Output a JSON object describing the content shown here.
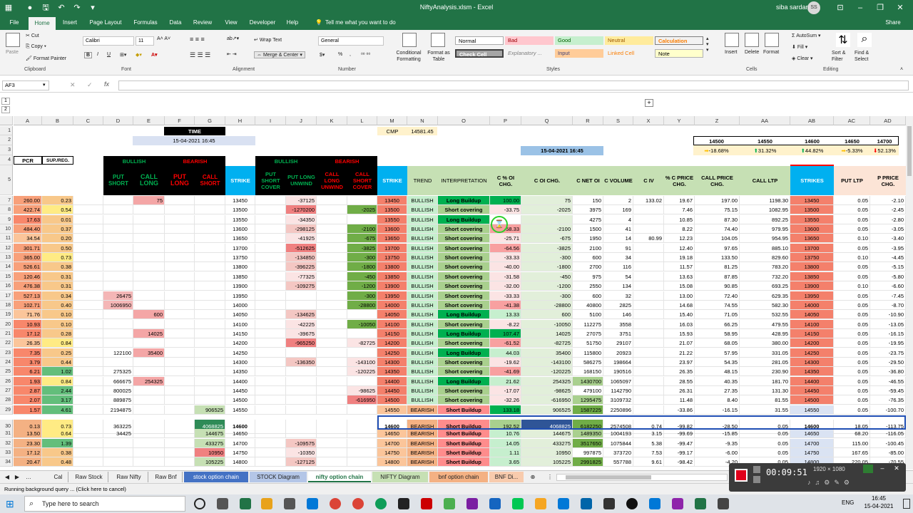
{
  "window": {
    "title": "NiftyAnalysis.xlsm - Excel",
    "user": "siba sardar",
    "avatar": "SS"
  },
  "menu": [
    "File",
    "Home",
    "Insert",
    "Page Layout",
    "Formulas",
    "Data",
    "Review",
    "Developer",
    "Help",
    "Tell me what you want to do",
    "Share"
  ],
  "ribbon": {
    "clipboard": {
      "paste": "Paste",
      "cut": "Cut",
      "copy": "Copy",
      "painter": "Format Painter",
      "label": "Clipboard"
    },
    "font": {
      "name": "Calibri",
      "size": "11",
      "label": "Font",
      "bold": "B",
      "italic": "I",
      "underline": "U"
    },
    "alignment": {
      "wrap": "Wrap Text",
      "merge": "Merge & Center",
      "label": "Alignment"
    },
    "number": {
      "format": "General",
      "label": "Number",
      "pct": "%"
    },
    "styles": {
      "cond": "Conditional Formatting",
      "table": "Format as Table",
      "normal": "Normal",
      "bad": "Bad",
      "good": "Good",
      "neutral": "Neutral",
      "calculation": "Calculation",
      "check": "Check Cell",
      "explanatory": "Explanatory ...",
      "input": "Input",
      "linked": "Linked Cell",
      "note": "Note",
      "label": "Styles"
    },
    "cells": {
      "insert": "Insert",
      "delete": "Delete",
      "format": "Format",
      "label": "Cells"
    },
    "editing": {
      "autosum": "AutoSum",
      "fill": "Fill",
      "clear": "Clear",
      "sort": "Sort & Filter",
      "find": "Find & Select",
      "label": "Editing"
    }
  },
  "formula": {
    "namebox": "AF3",
    "fx": "fx"
  },
  "columns": [
    "A",
    "B",
    "C",
    "D",
    "E",
    "F",
    "G",
    "H",
    "I",
    "J",
    "K",
    "L",
    "M",
    "N",
    "O",
    "P",
    "Q",
    "R",
    "S",
    "T",
    "U",
    "V",
    "W",
    "X",
    "Y",
    "Z",
    "AA",
    "AB",
    "AC",
    "AD"
  ],
  "top": {
    "time_label": "TIME",
    "time": "15-04-2021 16:45",
    "cmp_label": "CMP",
    "cmp": "14581.45",
    "time2": "15-04-2021 16:45",
    "strikes": [
      "14500",
      "14550",
      "14600",
      "14650",
      "14700"
    ],
    "pcts": [
      "-18.68%",
      "31.32%",
      "44.82%",
      "-5.33%",
      "52.13%"
    ]
  },
  "headers": {
    "pcr": "PCR",
    "supreg": "SUP./REG.",
    "bullish": "BULLISH",
    "bearish": "BEARISH",
    "put_short": "PUT SHORT",
    "call_long": "CALL LONG",
    "put_long": "PUT LONG",
    "call_short": "CALL SHORT",
    "strike": "STRIKE",
    "put_short_cover": "PUT SHORT COVER",
    "put_long_unwind": "PUT LONG UNWIND",
    "call_long_unwind": "CALL LONG UNWIND",
    "call_short_cover": "CALL SHORT COVER",
    "trend": "TREND",
    "interp": "INTERPRETATION",
    "c_pct_oi": "C % OI CHG.",
    "c_oi_chg": "C OI CHG.",
    "c_net_oi": "C NET OI",
    "c_volume": "C VOLUME",
    "c_iv": "C IV",
    "pct_c_price": "% C PRICE CHG.",
    "call_price_chg": "CALL PRICE CHG.",
    "call_ltp": "CALL LTP",
    "strikes": "STRIKES",
    "put_ltp": "PUT LTP",
    "p_price": "P PRICE CHG."
  },
  "rows": [
    {
      "n": "7",
      "a": "260.00",
      "b": "0.23",
      "e": "75",
      "h": "13450",
      "j": "-37125",
      "m": "13450",
      "t": "BULLISH",
      "i": "Long Buildup",
      "p": "100.00",
      "q": "75",
      "r": "150",
      "s": "2",
      "u": "133.02",
      "v": "19.67",
      "w": "197.00",
      "x": "1198.30",
      "ab": "13450",
      "ac": "0.05",
      "ad": "-2.10"
    },
    {
      "n": "8",
      "a": "422.74",
      "b": "0.54",
      "h": "13500",
      "j": "-1270200",
      "l": "-2025",
      "m": "13500",
      "t": "BULLISH",
      "i": "Short covering",
      "p": "-33.75",
      "q": "-2025",
      "r": "3975",
      "s": "169",
      "v": "7.46",
      "w": "75.15",
      "x": "1082.95",
      "ab": "13500",
      "ac": "0.05",
      "ad": "-2.45"
    },
    {
      "n": "9",
      "a": "17.63",
      "b": "0.01",
      "h": "13550",
      "j": "-34350",
      "m": "13550",
      "t": "BULLISH",
      "i": "Long Buildup",
      "p": "",
      "q": "",
      "r": "4275",
      "s": "4",
      "v": "10.85",
      "w": "87.30",
      "x": "892.25",
      "ab": "13550",
      "ac": "0.05",
      "ad": "-2.80"
    },
    {
      "n": "10",
      "a": "484.40",
      "b": "0.37",
      "h": "13600",
      "j": "-298125",
      "l": "-2100",
      "m": "13600",
      "t": "BULLISH",
      "i": "Short covering",
      "p": "-58.33",
      "q": "-2100",
      "r": "1500",
      "s": "41",
      "v": "8.22",
      "w": "74.40",
      "x": "979.95",
      "ab": "13600",
      "ac": "0.05",
      "ad": "-3.05"
    },
    {
      "n": "11",
      "a": "34.54",
      "b": "0.20",
      "h": "13650",
      "j": "-41925",
      "l": "-675",
      "m": "13650",
      "t": "BULLISH",
      "i": "Short covering",
      "p": "-25.71",
      "q": "-675",
      "r": "1950",
      "s": "14",
      "u": "80.99",
      "v": "12.23",
      "w": "104.05",
      "x": "954.95",
      "ab": "13650",
      "ac": "0.10",
      "ad": "-3.40"
    },
    {
      "n": "12",
      "a": "301.71",
      "b": "0.50",
      "h": "13700",
      "j": "-512625",
      "l": "-3825",
      "m": "13700",
      "t": "BULLISH",
      "i": "Short covering",
      "p": "-64.56",
      "q": "-3825",
      "r": "2100",
      "s": "91",
      "v": "12.40",
      "w": "97.65",
      "x": "885.10",
      "ab": "13700",
      "ac": "0.05",
      "ad": "-3.95"
    },
    {
      "n": "13",
      "a": "365.00",
      "b": "0.73",
      "h": "13750",
      "j": "-134850",
      "l": "-300",
      "m": "13750",
      "t": "BULLISH",
      "i": "Short covering",
      "p": "-33.33",
      "q": "-300",
      "r": "600",
      "s": "34",
      "v": "19.18",
      "w": "133.50",
      "x": "829.60",
      "ab": "13750",
      "ac": "0.10",
      "ad": "-4.45"
    },
    {
      "n": "14",
      "a": "526.61",
      "b": "0.38",
      "h": "13800",
      "j": "-396225",
      "l": "-1800",
      "m": "13800",
      "t": "BULLISH",
      "i": "Short covering",
      "p": "-40.00",
      "q": "-1800",
      "r": "2700",
      "s": "116",
      "v": "11.57",
      "w": "81.25",
      "x": "783.20",
      "ab": "13800",
      "ac": "0.05",
      "ad": "-5.15"
    },
    {
      "n": "15",
      "a": "120.46",
      "b": "0.31",
      "h": "13850",
      "j": "-77325",
      "l": "-450",
      "m": "13850",
      "t": "BULLISH",
      "i": "Short covering",
      "p": "-31.58",
      "q": "-450",
      "r": "975",
      "s": "54",
      "v": "13.63",
      "w": "87.85",
      "x": "732.20",
      "ab": "13850",
      "ac": "0.05",
      "ad": "-5.80"
    },
    {
      "n": "16",
      "a": "476.38",
      "b": "0.31",
      "h": "13900",
      "j": "-109275",
      "l": "-1200",
      "m": "13900",
      "t": "BULLISH",
      "i": "Short covering",
      "p": "-32.00",
      "q": "-1200",
      "r": "2550",
      "s": "134",
      "v": "15.08",
      "w": "90.85",
      "x": "693.25",
      "ab": "13900",
      "ac": "0.10",
      "ad": "-6.60"
    },
    {
      "n": "17",
      "a": "527.13",
      "b": "0.34",
      "d": "26475",
      "h": "13950",
      "l": "-300",
      "m": "13950",
      "t": "BULLISH",
      "i": "Short covering",
      "p": "-33.33",
      "q": "-300",
      "r": "600",
      "s": "32",
      "v": "13.00",
      "w": "72.40",
      "x": "629.35",
      "ab": "13950",
      "ac": "0.05",
      "ad": "-7.45"
    },
    {
      "n": "18",
      "a": "102.71",
      "b": "0.40",
      "d": "1006950",
      "h": "14000",
      "l": "-28800",
      "m": "14000",
      "t": "BULLISH",
      "i": "Short covering",
      "p": "-41.38",
      "q": "-28800",
      "r": "40800",
      "s": "2825",
      "v": "14.68",
      "w": "74.55",
      "x": "582.30",
      "ab": "14000",
      "ac": "0.05",
      "ad": "-8.70"
    },
    {
      "n": "19",
      "a": "71.76",
      "b": "0.10",
      "e": "600",
      "h": "14050",
      "j": "-134625",
      "m": "14050",
      "t": "BULLISH",
      "i": "Long Buildup",
      "p": "13.33",
      "q": "600",
      "r": "5100",
      "s": "146",
      "v": "15.40",
      "w": "71.05",
      "x": "532.55",
      "ab": "14050",
      "ac": "0.05",
      "ad": "-10.90"
    },
    {
      "n": "20",
      "a": "10.93",
      "b": "0.10",
      "h": "14100",
      "j": "-42225",
      "l": "-10050",
      "m": "14100",
      "t": "BULLISH",
      "i": "Short covering",
      "p": "-8.22",
      "q": "-10050",
      "r": "112275",
      "s": "3558",
      "v": "16.03",
      "w": "66.25",
      "x": "479.55",
      "ab": "14100",
      "ac": "0.05",
      "ad": "-13.05"
    },
    {
      "n": "21",
      "a": "17.12",
      "b": "0.28",
      "e": "14025",
      "h": "14150",
      "j": "-39675",
      "m": "14150",
      "t": "BULLISH",
      "i": "Long Buildup",
      "p": "107.47",
      "q": "14025",
      "r": "27075",
      "s": "3751",
      "v": "15.93",
      "w": "58.95",
      "x": "428.95",
      "ab": "14150",
      "ac": "0.05",
      "ad": "-16.15"
    },
    {
      "n": "22",
      "a": "26.35",
      "b": "0.84",
      "h": "14200",
      "j": "-965250",
      "l": "-82725",
      "m": "14200",
      "t": "BULLISH",
      "i": "Short covering",
      "p": "-61.52",
      "q": "-82725",
      "r": "51750",
      "s": "29107",
      "v": "21.07",
      "w": "68.05",
      "x": "380.00",
      "ab": "14200",
      "ac": "0.05",
      "ad": "-19.95"
    },
    {
      "n": "23",
      "a": "7.35",
      "b": "0.25",
      "d": "122100",
      "e": "35400",
      "h": "14250",
      "m": "14250",
      "t": "BULLISH",
      "i": "Long Buildup",
      "p": "44.03",
      "q": "35400",
      "r": "115800",
      "s": "20923",
      "v": "21.22",
      "w": "57.95",
      "x": "331.05",
      "ab": "14250",
      "ac": "0.05",
      "ad": "-23.75"
    },
    {
      "n": "24",
      "a": "3.79",
      "b": "0.44",
      "h": "14300",
      "j": "-136350",
      "l": "-143100",
      "m": "14300",
      "t": "BULLISH",
      "i": "Short covering",
      "p": "-19.62",
      "q": "-143100",
      "r": "586275",
      "s": "198664",
      "v": "23.97",
      "w": "54.35",
      "x": "281.05",
      "ab": "14300",
      "ac": "0.05",
      "ad": "-29.50"
    },
    {
      "n": "25",
      "a": "6.21",
      "b": "1.02",
      "d": "275325",
      "h": "14350",
      "l": "-120225",
      "m": "14350",
      "t": "BULLISH",
      "i": "Short covering",
      "p": "-41.69",
      "q": "-120225",
      "r": "168150",
      "s": "190516",
      "v": "26.35",
      "w": "48.15",
      "x": "230.90",
      "ab": "14350",
      "ac": "0.05",
      "ad": "-36.80"
    },
    {
      "n": "26",
      "a": "1.93",
      "b": "0.84",
      "d": "666675",
      "e": "254325",
      "h": "14400",
      "m": "14400",
      "t": "BULLISH",
      "i": "Long Buildup",
      "p": "21.62",
      "q": "254325",
      "r": "1430700",
      "s": "1065097",
      "v": "28.55",
      "w": "40.35",
      "x": "181.70",
      "ab": "14400",
      "ac": "0.05",
      "ad": "-46.55"
    },
    {
      "n": "27",
      "a": "2.87",
      "b": "2.44",
      "d": "800025",
      "h": "14450",
      "l": "-98625",
      "m": "14450",
      "t": "BULLISH",
      "i": "Short covering",
      "p": "-17.07",
      "q": "-98625",
      "r": "479100",
      "s": "1142790",
      "v": "26.31",
      "w": "27.35",
      "x": "131.30",
      "ab": "14450",
      "ac": "0.05",
      "ad": "-59.45"
    },
    {
      "n": "28",
      "a": "2.07",
      "b": "3.17",
      "d": "889875",
      "h": "14500",
      "l": "-616950",
      "m": "14500",
      "t": "BULLISH",
      "i": "Short covering",
      "p": "-32.26",
      "q": "-616950",
      "r": "1295475",
      "s": "3109732",
      "v": "11.48",
      "w": "8.40",
      "x": "81.55",
      "ab": "14500",
      "ac": "0.05",
      "ad": "-76.35"
    },
    {
      "n": "29",
      "a": "1.57",
      "b": "4.61",
      "d": "2194875",
      "g": "906525",
      "h": "14550",
      "m": "14550",
      "t": "BEARISH",
      "i": "Short Buildup",
      "p": "133.18",
      "q": "906525",
      "r": "1587225",
      "s": "2250896",
      "v": "-33.86",
      "w": "-16.15",
      "x": "31.55",
      "ab": "14550",
      "ac": "0.05",
      "ad": "-100.70"
    },
    {
      "n": "30",
      "a": "0.13",
      "b": "0.73",
      "d": "363225",
      "g": "4068825",
      "h": "14600",
      "m": "14600",
      "t": "BEARISH",
      "i": "Short Buildup",
      "p": "192.52",
      "q": "4068825",
      "r": "6182250",
      "s": "2574508",
      "u": "0.74",
      "v": "-99.82",
      "w": "-28.50",
      "x": "0.05",
      "ab": "14600",
      "ac": "18.05",
      "ad": "-113.75"
    },
    {
      "n": "31",
      "a": "13.50",
      "b": "0.64",
      "d": "34425",
      "g": "144675",
      "h": "14650",
      "m": "14650",
      "t": "BEARISH",
      "i": "Short Buildup",
      "p": "10.76",
      "q": "144675",
      "r": "1489350",
      "s": "1004193",
      "u": "3.15",
      "v": "-99.69",
      "w": "-15.85",
      "x": "0.05",
      "ab": "14650",
      "ac": "68.20",
      "ad": "-116.05"
    },
    {
      "n": "32",
      "a": "23.30",
      "b": "1.39",
      "g": "433275",
      "h": "14700",
      "j": "-109575",
      "m": "14700",
      "t": "BEARISH",
      "i": "Short Buildup",
      "p": "14.05",
      "q": "433275",
      "r": "3517650",
      "s": "1075844",
      "u": "5.38",
      "v": "-99.47",
      "w": "-9.35",
      "x": "0.05",
      "ab": "14700",
      "ac": "115.00",
      "ad": "-100.45"
    },
    {
      "n": "33",
      "a": "17.12",
      "b": "0.38",
      "g": "10950",
      "h": "14750",
      "j": "-10350",
      "m": "14750",
      "t": "BEARISH",
      "i": "Short Buildup",
      "p": "1.11",
      "q": "10950",
      "r": "997875",
      "s": "373720",
      "u": "7.53",
      "v": "-99.17",
      "w": "-6.00",
      "x": "0.05",
      "ab": "14750",
      "ac": "167.65",
      "ad": "-85.00"
    },
    {
      "n": "34",
      "a": "20.47",
      "b": "0.48",
      "g": "105225",
      "h": "14800",
      "j": "-127125",
      "m": "14800",
      "t": "BEARISH",
      "i": "Short Buildup",
      "p": "3.65",
      "q": "105225",
      "r": "2991825",
      "s": "557788",
      "u": "9.61",
      "v": "-98.42",
      "w": "-4.20",
      "x": "0.05",
      "ab": "14800",
      "ac": "220.05",
      "ad": "-70.55"
    }
  ],
  "sheets": [
    "Cal",
    "Raw Stock",
    "Raw Nifty",
    "Raw Bnf",
    "stock option chain",
    "STOCK Diagram",
    "nifty option chain",
    "NIFTY Diagram",
    "bnf option chain",
    "BNF Di..."
  ],
  "status": "Running background query ... (Click here to cancel)",
  "recorder": {
    "time": "00:09:51",
    "res": "1920 × 1080"
  },
  "taskbar": {
    "search": "Type here to search",
    "lang": "ENG",
    "time": "16:45",
    "date": "15-04-2021"
  }
}
